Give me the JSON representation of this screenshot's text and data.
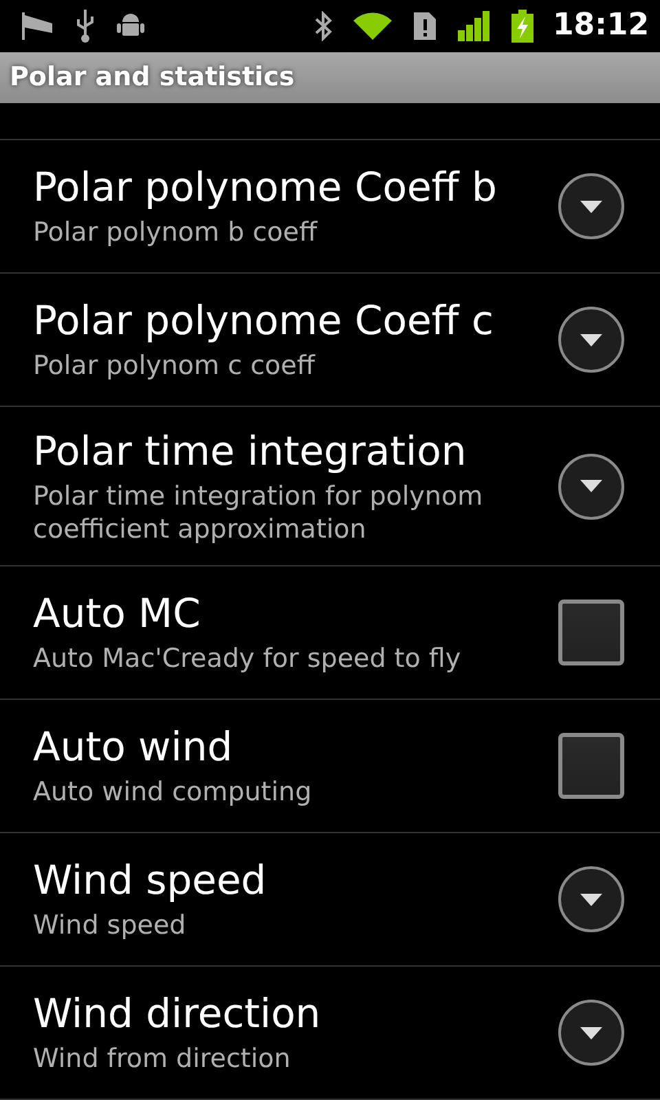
{
  "status_bar": {
    "time": "18:12"
  },
  "title": "Polar and statistics",
  "items": [
    {
      "kind": "list",
      "title": "Polar polynome Coeff b",
      "summary": "Polar polynom b coeff"
    },
    {
      "kind": "list",
      "title": "Polar polynome Coeff c",
      "summary": "Polar polynom c coeff"
    },
    {
      "kind": "list",
      "title": "Polar time integration",
      "summary": "Polar time integration for polynom coefficient approximation"
    },
    {
      "kind": "checkbox",
      "title": "Auto MC",
      "summary": "Auto Mac'Cready for speed to fly",
      "checked": false
    },
    {
      "kind": "checkbox",
      "title": "Auto wind",
      "summary": "Auto wind computing",
      "checked": false
    },
    {
      "kind": "list",
      "title": "Wind speed",
      "summary": "Wind speed"
    },
    {
      "kind": "list",
      "title": "Wind direction",
      "summary": "Wind from direction"
    }
  ]
}
